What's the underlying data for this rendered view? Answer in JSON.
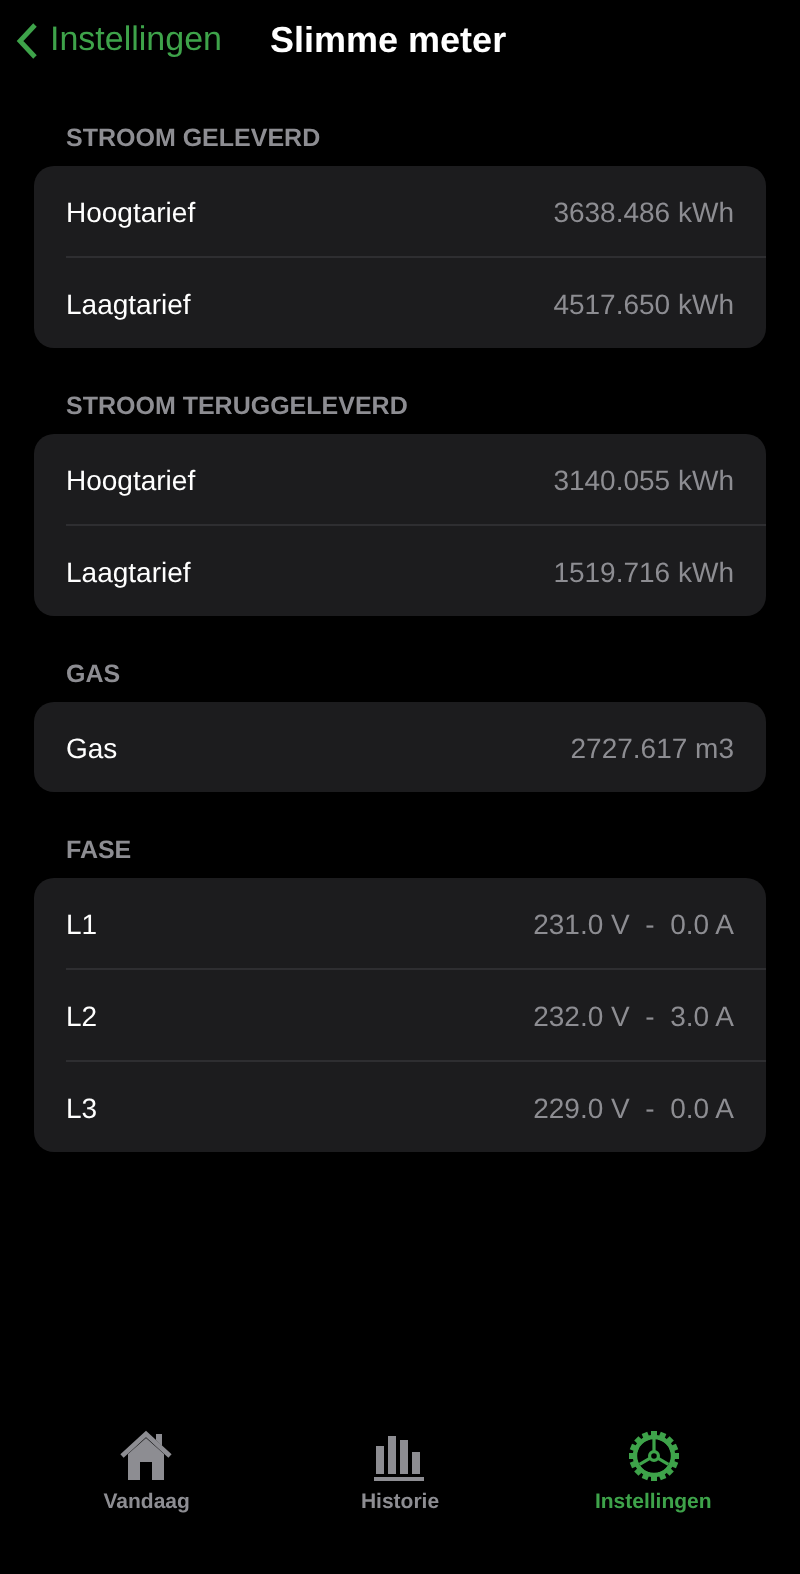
{
  "nav": {
    "back_label": "Instellingen",
    "title": "Slimme meter"
  },
  "sections": [
    {
      "header": "STROOM GELEVERD",
      "rows": [
        {
          "label": "Hoogtarief",
          "value": "3638.486 kWh"
        },
        {
          "label": "Laagtarief",
          "value": "4517.650 kWh"
        }
      ]
    },
    {
      "header": "STROOM TERUGGELEVERD",
      "rows": [
        {
          "label": "Hoogtarief",
          "value": "3140.055 kWh"
        },
        {
          "label": "Laagtarief",
          "value": "1519.716 kWh"
        }
      ]
    },
    {
      "header": "GAS",
      "rows": [
        {
          "label": "Gas",
          "value": "2727.617 m3"
        }
      ]
    },
    {
      "header": "FASE",
      "rows": [
        {
          "label": "L1",
          "value": "231.0 V  -  0.0 A"
        },
        {
          "label": "L2",
          "value": "232.0 V  -  3.0 A"
        },
        {
          "label": "L3",
          "value": "229.0 V  -  0.0 A"
        }
      ]
    }
  ],
  "tab_bar": [
    {
      "kind": "home",
      "label": "Vandaag",
      "selected": false
    },
    {
      "kind": "chart",
      "label": "Historie",
      "selected": false
    },
    {
      "kind": "gear",
      "label": "Instellingen",
      "selected": true
    }
  ]
}
